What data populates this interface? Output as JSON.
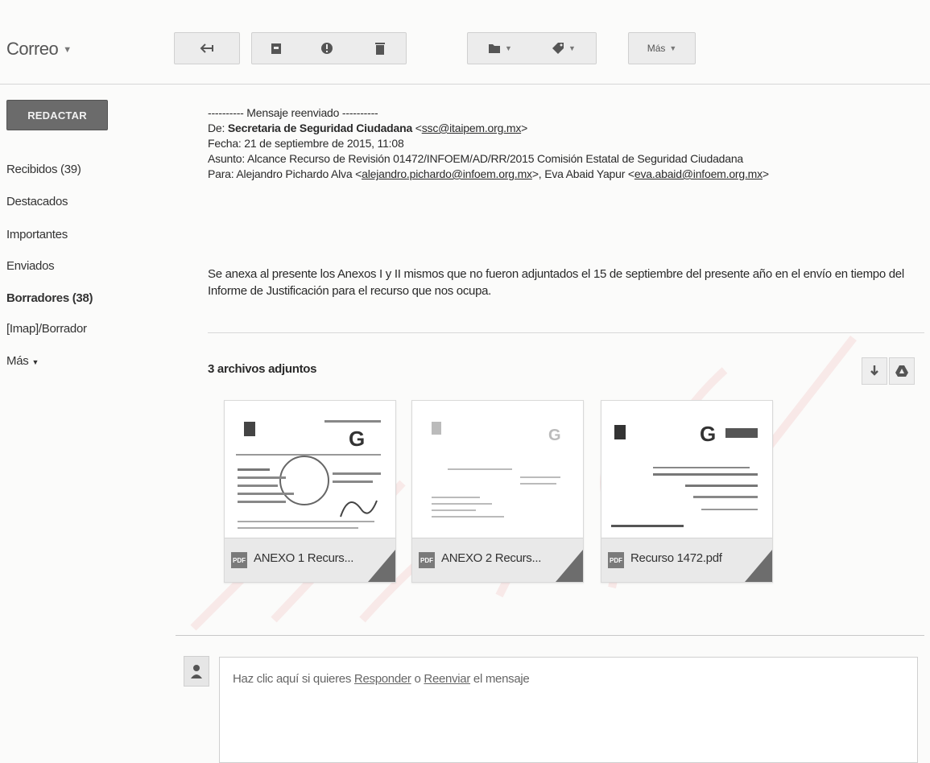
{
  "header": {
    "app_title": "Correo",
    "more_label": "Más"
  },
  "toolbar": {
    "icons": [
      "back-arrow-icon",
      "archive-icon",
      "report-spam-icon",
      "trash-icon",
      "folder-move-icon",
      "label-icon"
    ]
  },
  "sidebar": {
    "compose_label": "REDACTAR",
    "items": [
      {
        "label": "Recibidos (39)",
        "bold": false
      },
      {
        "label": "Destacados",
        "bold": false
      },
      {
        "label": "Importantes",
        "bold": false
      },
      {
        "label": "Enviados",
        "bold": false
      },
      {
        "label": "Borradores (38)",
        "bold": true
      },
      {
        "label": "[Imap]/Borrador",
        "bold": false
      },
      {
        "label": "Más",
        "bold": false
      }
    ]
  },
  "message": {
    "forward_header": "---------- Mensaje reenviado ----------",
    "from_label": "De:",
    "from_name": "Secretaria de Seguridad Ciudadana",
    "from_email": "ssc@itaipem.org.mx",
    "date_line": "Fecha: 21 de septiembre de 2015, 11:08",
    "subject_line": "Asunto: Alcance Recurso de Revisión 01472/INFOEM/AD/RR/2015 Comisión Estatal de Seguridad Ciudadana",
    "to_label": "Para:",
    "to_name_1": "Alejandro Pichardo Alva",
    "to_email_1": "alejandro.pichardo@infoem.org.mx",
    "to_name_2": "Eva Abaid Yapur",
    "to_email_2": "eva.abaid@infoem.org.mx",
    "body": "Se anexa al presente los Anexos I y II mismos que no fueron adjuntados el 15 de septiembre del presente año en el envío en tiempo del Informe de Justificación para el recurso que nos ocupa."
  },
  "attachments": {
    "title": "3 archivos adjuntos",
    "items": [
      {
        "name": "ANEXO 1 Recurs..."
      },
      {
        "name": "ANEXO 2 Recurs..."
      },
      {
        "name": "Recurso 1472.pdf"
      }
    ],
    "file_type": "PDF"
  },
  "reply": {
    "prefix": "Haz clic aquí si quieres",
    "reply_link": "Responder",
    "middle": "o",
    "forward_link": "Reenviar",
    "suffix": "el mensaje"
  },
  "colors": {
    "watermark": "#e04a4a",
    "compose_bg": "#6b6b6b",
    "toolbar_bg": "#ececec"
  }
}
